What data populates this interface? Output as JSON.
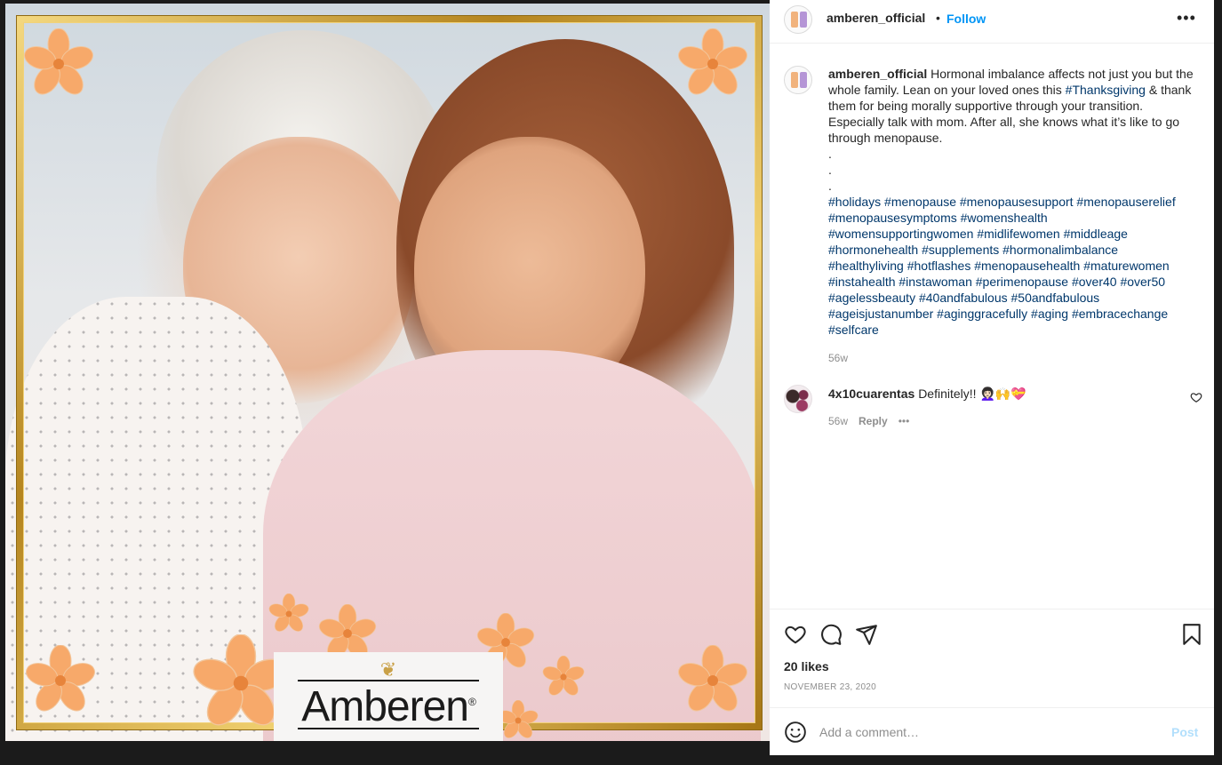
{
  "post": {
    "image_alt": "Amberen Thanksgiving photo",
    "brand_logo_text": "Amberen",
    "brand_logo_mark": "®"
  },
  "header": {
    "username": "amberen_official",
    "separator": "•",
    "follow_label": "Follow",
    "more_icon": "more-horizontal-icon"
  },
  "caption": {
    "username": "amberen_official",
    "text_part1": "Hormonal imbalance affects not just you but the whole family. Lean on your loved ones this ",
    "hashtag_inline": "#Thanksgiving",
    "text_part2": " & thank them for being morally supportive through your transition. Especially talk with mom. After all, she knows what it’s like to go through menopause.",
    "dots": [
      ".",
      ".",
      "."
    ],
    "hashtag_lines": [
      "#holidays #menopause #menopausesupport #menopauserelief",
      "#menopausesymptoms #womenshealth",
      "#womensupportingwomen #midlifewomen #middleage",
      "#hormonehealth #supplements #hormonalimbalance",
      "#healthyliving #hotflashes #menopausehealth #maturewomen",
      "#instahealth #instawoman #perimenopause #over40 #over50",
      "#agelessbeauty #40andfabulous #50andfabulous",
      "#ageisjustanumber #aginggracefully #aging #embracechange",
      "#selfcare"
    ],
    "age": "56w"
  },
  "comment": {
    "username": "4x10cuarentas",
    "text": "Definitely!!",
    "emojis": "👩🏻‍🦱🙌💝",
    "age": "56w",
    "reply_label": "Reply",
    "more_label": "•••"
  },
  "actions": {
    "likes": "20 likes",
    "date": "NOVEMBER 23, 2020"
  },
  "comment_box": {
    "placeholder": "Add a comment…",
    "post_label": "Post"
  },
  "colors": {
    "follow_blue": "#0095f6",
    "hashtag_blue": "#00376b",
    "muted_gray": "#8e8e8e",
    "post_disabled": "#b2dffc",
    "frame_gold": "#c99a2e",
    "flower_orange": "#f7a96a"
  }
}
